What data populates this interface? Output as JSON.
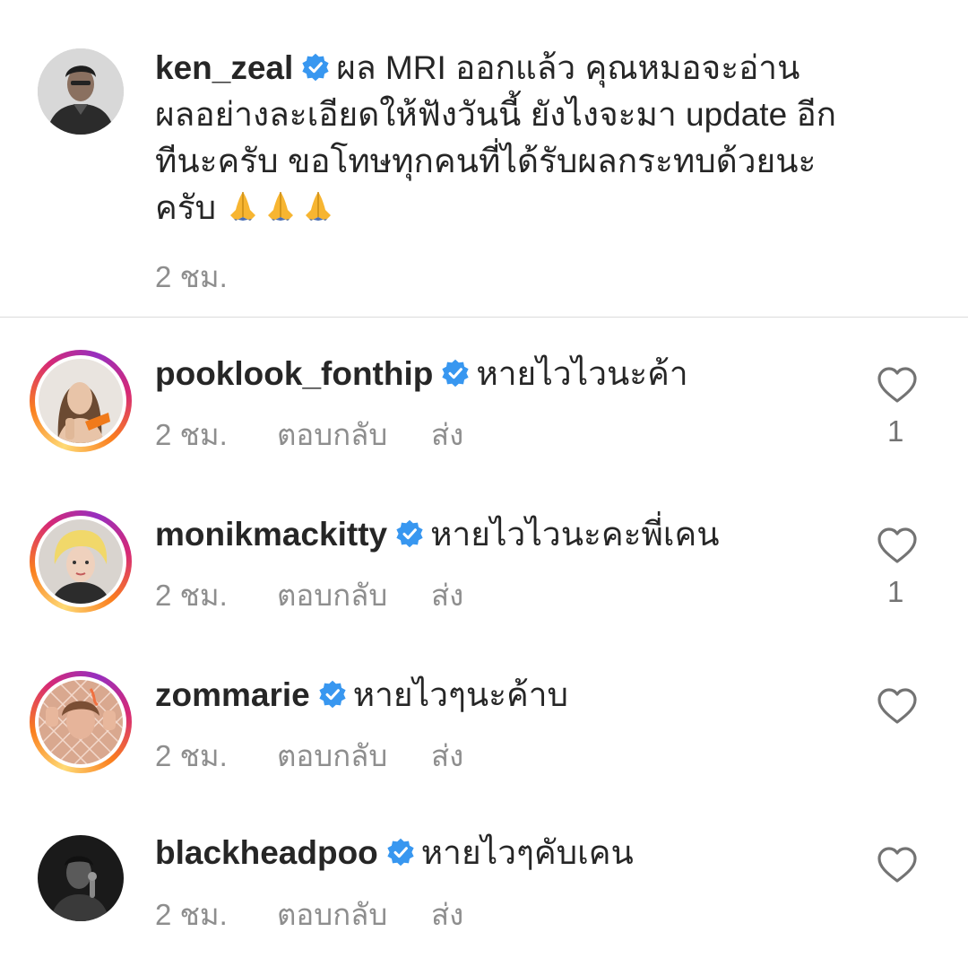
{
  "caption": {
    "username": "ken_zeal",
    "lines": [
      "ผล MRI ออกแล้ว คุณหมอจะอ่าน",
      "ผลอย่างละเอียดให้ฟังวันนี้ ยังไงจะมา update อีก",
      "ทีนะครับ ขอโทษทุกคนที่ได้รับผลกระทบด้วยนะ",
      "ครับ"
    ],
    "emoji": "folded-hands x3",
    "time": "2 ชม."
  },
  "actions": {
    "reply_label": "ตอบกลับ",
    "send_label": "ส่ง"
  },
  "comments": [
    {
      "username": "pooklook_fonthip",
      "text": "หายไวไวนะค้า",
      "time": "2 ชม.",
      "likes": "1"
    },
    {
      "username": "monikmackitty",
      "text": "หายไวไวนะคะพี่เคน",
      "time": "2 ชม.",
      "likes": "1"
    },
    {
      "username": "zommarie",
      "text": "หายไวๆนะค้าบ",
      "time": "2 ชม.",
      "likes": ""
    },
    {
      "username": "blackheadpoo",
      "text": "หายไวๆคับเคน",
      "time": "2 ชม.",
      "likes": ""
    }
  ],
  "colors": {
    "text": "#262626",
    "meta": "#8e8e8e",
    "verified": "#3897f0",
    "divider": "#dbdbdb"
  }
}
